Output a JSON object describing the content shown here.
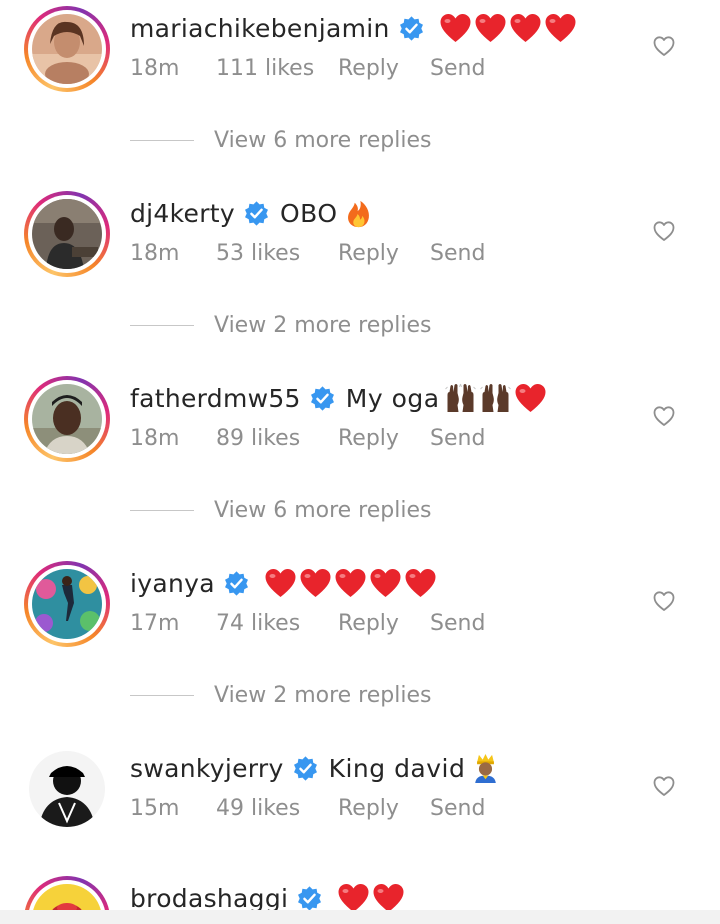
{
  "comments": [
    {
      "username": "mariachikebenjamin",
      "verified": true,
      "text": "",
      "emoji": [
        "red-heart",
        "red-heart",
        "red-heart",
        "red-heart"
      ],
      "time": "18m",
      "likes": "111 likes",
      "reply_label": "Reply",
      "send_label": "Send",
      "view_replies": "View 6 more replies"
    },
    {
      "username": "dj4kerty",
      "verified": true,
      "text": "OBO",
      "emoji": [
        "fire"
      ],
      "time": "18m",
      "likes": "53 likes",
      "reply_label": "Reply",
      "send_label": "Send",
      "view_replies": "View 2 more replies"
    },
    {
      "username": "fatherdmw55",
      "verified": true,
      "text": "My oga",
      "emoji": [
        "raising-hands-dark",
        "raising-hands-dark",
        "red-heart"
      ],
      "time": "18m",
      "likes": "89 likes",
      "reply_label": "Reply",
      "send_label": "Send",
      "view_replies": "View 6 more replies"
    },
    {
      "username": "iyanya",
      "verified": true,
      "text": "",
      "emoji": [
        "red-heart",
        "red-heart",
        "red-heart",
        "red-heart",
        "red-heart"
      ],
      "time": "17m",
      "likes": "74 likes",
      "reply_label": "Reply",
      "send_label": "Send",
      "view_replies": "View 2 more replies"
    },
    {
      "username": "swankyjerry",
      "verified": true,
      "text": "King david",
      "emoji": [
        "prince"
      ],
      "time": "15m",
      "likes": "49 likes",
      "reply_label": "Reply",
      "send_label": "Send",
      "view_replies": ""
    },
    {
      "username": "brodashaggi",
      "verified": true,
      "text": "",
      "emoji": [
        "red-heart",
        "red-heart"
      ],
      "time": "",
      "likes": "",
      "reply_label": "",
      "send_label": "",
      "view_replies": ""
    }
  ],
  "colors": {
    "verified_blue": "#3897f0",
    "heart_red": "#e8242c",
    "meta_gray": "#8e8e8e",
    "text_dark": "#262626"
  },
  "icons": {
    "verified": "verified-badge-icon",
    "like": "heart-outline-icon"
  }
}
